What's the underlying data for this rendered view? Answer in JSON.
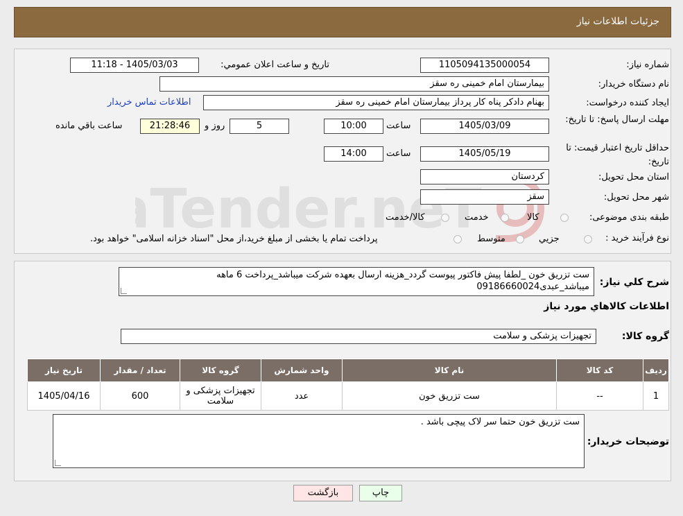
{
  "header": {
    "title": "جزئیات اطلاعات نیاز"
  },
  "form": {
    "need_number_label": "شماره نیاز:",
    "need_number": "1105094135000054",
    "announce_label": "تاریخ و ساعت اعلان عمومي:",
    "announce_value": "1405/03/03 - 11:18",
    "buyer_org_label": "نام دستگاه خريدار:",
    "buyer_org": "بیمارستان امام خمینی  ره  سقز",
    "requester_label": "ايجاد کننده درخواست:",
    "requester": "بهنام دادکر پناه کار پرداز بیمارستان امام خمینی  ره  سقز",
    "contact_link": "اطلاعات تماس خريدار",
    "deadline_label": "مهلت ارسال پاسخ: تا تاریخ:",
    "deadline_date": "1405/03/09",
    "time_label": "ساعت",
    "deadline_time": "10:00",
    "days_value": "5",
    "days_label": "روز و",
    "remaining_value": "21:28:46",
    "remaining_label": "ساعت باقي مانده",
    "validity_label": "حداقل تاريخ اعتبار قيمت: تا تاریخ:",
    "validity_date": "1405/05/19",
    "validity_time": "14:00",
    "province_label": "استان محل تحويل:",
    "province": "كردستان",
    "city_label": "شهر محل تحويل:",
    "city": "سقز",
    "category_label": "طبقه بندی موضوعی:",
    "category_options": [
      "كالا",
      "خدمت",
      "كالا/خدمت"
    ],
    "process_label": "نوع فرآيند خريد :",
    "process_options": [
      "جزيي",
      "متوسط"
    ],
    "process_note": "پرداخت تمام یا بخشی از مبلغ خرید،از محل \"اسناد خزانه اسلامی\" خواهد بود."
  },
  "details": {
    "summary_label": "شرح كلي نياز:",
    "summary_line1": "ست تزریق خون  _لطفا پیش فاکتور پیوست گردد_هزینه ارسال بعهده شرکت میباشد_پرداخت 6 ماهه",
    "summary_line2": "میباشد_عبدی09186660024",
    "goods_info_title": "اطلاعات كالاهاي مورد نياز",
    "goods_group_label": "گروه كالا:",
    "goods_group": "تجهيزات پزشكی و سلامت"
  },
  "table": {
    "headers": [
      "رديف",
      "كد كالا",
      "نام كالا",
      "واحد شمارش",
      "گروه كالا",
      "تعداد / مقدار",
      "تاريخ نياز"
    ],
    "rows": [
      [
        "1",
        "--",
        "ست تزریق خون",
        "عدد",
        "تجهيزات پزشكی و سلامت",
        "600",
        "1405/04/16"
      ]
    ]
  },
  "buyer_notes": {
    "label": "توضيحات خريدار:",
    "text": "ست تزریق خون  حتما سر لاک پیچی باشد ."
  },
  "buttons": {
    "print": "چاپ",
    "back": "بازگشت"
  },
  "colors": {
    "header_bg": "#8a6a3e",
    "table_header_bg": "#7a6e66",
    "remaining_bg": "#ffffd9",
    "print_bg": "#eaffea",
    "back_bg": "#ffe5e5",
    "link": "#1a3fbf"
  }
}
